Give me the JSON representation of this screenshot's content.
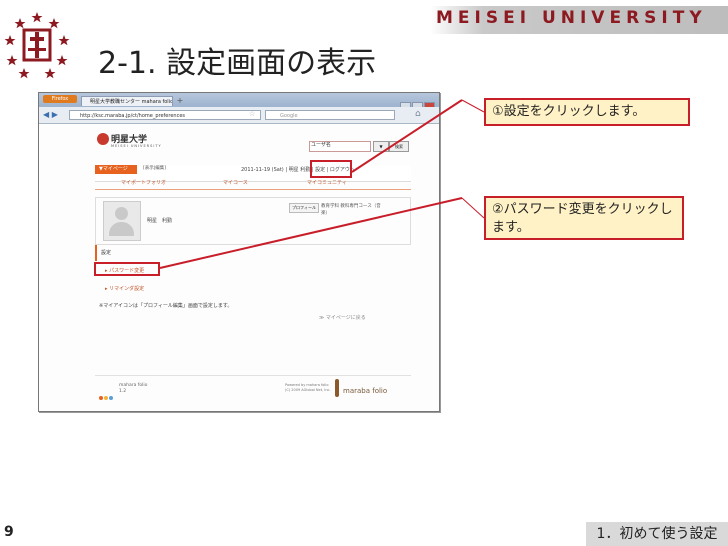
{
  "header": {
    "university_name": "MEISEI UNIVERSITY",
    "title": "2-1. 設定画面の表示"
  },
  "browser": {
    "app_button": "Firefox",
    "tab_title": "明星大学教職センター mahara folio -...",
    "url": "http://ksc.maraba.jp/ct/home_preferences",
    "search_placeholder": "Google",
    "page": {
      "logo_text": "明星大学",
      "logo_sub": "MEISEI UNIVERSITY",
      "user_field": "ユーザ名",
      "lang_button": "▼",
      "search_button": "検索",
      "mypage_tab": "▼マイページ",
      "edit_buttons": "[表示|編集]",
      "date_line": "2011-11-19 (Sat) | 明星 利勤 | 設定 | ログアウト",
      "subnav": [
        "マイポートフォリオ",
        "マイコース",
        "マイコミュニティ"
      ],
      "username": "明星　利勤",
      "profile_button": "プロフィール",
      "department": "教育学科 教科専門コース（音楽）",
      "settings_heading": "設定",
      "password_link": "▸ パスワード変更",
      "reminder_link": "▸ リマインダ設定",
      "note": "※マイアイコンは「プロフィール編集」画面で設定します。",
      "back_link": "≫ マイページに戻る",
      "footer_text": "mahara folio",
      "footer_version": "1.2",
      "footer_powered": "Powered by mahara folio",
      "footer_copyright": "(C) 2009 AGlobal Net, Inc.",
      "footer_brand": "maraba folio"
    }
  },
  "callouts": {
    "step1": "①設定をクリックします。",
    "step2": "②パスワード変更をクリックします。"
  },
  "footer": {
    "page_number": "9",
    "section": "1．初めて使う設定"
  },
  "colors": {
    "accent_red": "#c81e2a",
    "callout_bg": "#fff2c6",
    "brand_orange": "#e6621e"
  }
}
